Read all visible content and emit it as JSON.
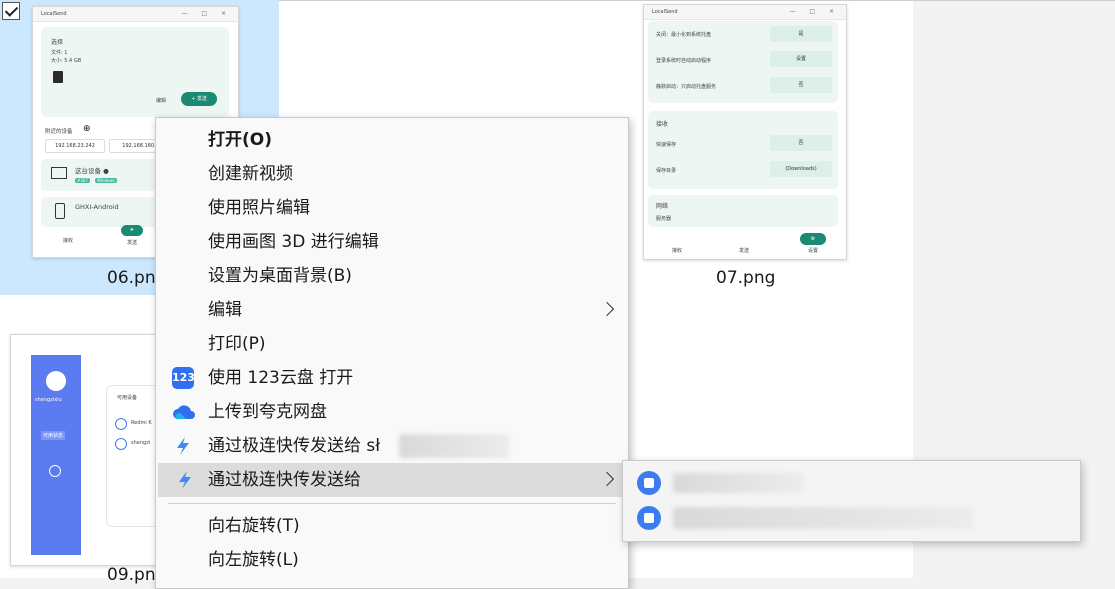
{
  "files": [
    {
      "name": "06.png",
      "selected": true
    },
    {
      "name": "07.png",
      "selected": false
    },
    {
      "name": "09.png",
      "selected": false
    }
  ],
  "thumb06": {
    "app_title": "LocalSend",
    "card_title": "选择",
    "card_line1": "文件: 1",
    "card_line2": "大小: 5.4 GB",
    "edit": "编辑",
    "send": "+ 发送",
    "nearby": "附近的设备",
    "ip1": "192.168.23.242",
    "ip2": "192.168.160.",
    "device1": "这台设备 ●",
    "device1_tag1": "#307",
    "device1_tag2": "Windows",
    "device2": "GHXI-Android",
    "nav_recv": "接收",
    "nav_send": "发送"
  },
  "thumb07": {
    "app_title": "LocalSend",
    "row1": "关闭：最小化到系统托盘",
    "row1_val": "是",
    "row2": "登录系统时自动启动程序",
    "row2_val": "设置",
    "row3": "静默启动：只启动托盘服务",
    "row3_val": "否",
    "sec2": "接收",
    "row4": "快速保存",
    "row4_val": "否",
    "row5": "保存目录",
    "row5_val": "(Downloads)",
    "sec3": "网络",
    "row6": "服务器",
    "nav1": "接收",
    "nav2": "发送",
    "nav3": "设置"
  },
  "thumb09": {
    "user": "shengzixiu",
    "item1": "Redmi K",
    "item2": "shengzi",
    "list_title": "可用设备",
    "btn": "可用状态"
  },
  "menu": {
    "open": "打开(O)",
    "new_video": "创建新视频",
    "photo_edit": "使用照片编辑",
    "paint3d": "使用画图 3D 进行编辑",
    "wallpaper": "设置为桌面背景(B)",
    "edit": "编辑",
    "print": "打印(P)",
    "open_123": "使用 123云盘 打开",
    "upload_quark": "上传到夸克网盘",
    "send_fast_to": "通过极连快传发送给 sł",
    "send_fast": "通过极连快传发送给",
    "rotate_right": "向右旋转(T)",
    "rotate_left": "向左旋转(L)"
  },
  "icons": {
    "app123": "cloud-123-icon",
    "quark": "quark-cloud-icon",
    "fast": "lightning-icon"
  },
  "colors": {
    "selection": "#cce8ff",
    "accent_blue": "#3d7cf0",
    "localsend_green": "#1a8a73"
  }
}
